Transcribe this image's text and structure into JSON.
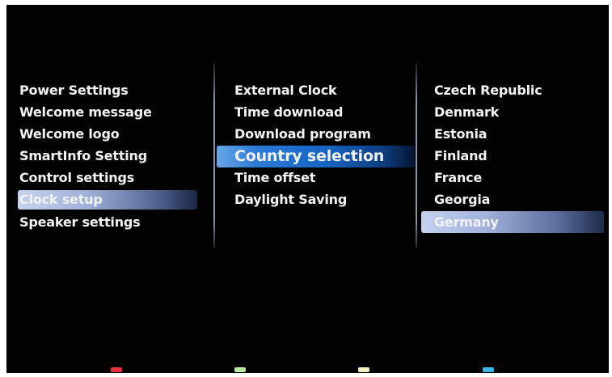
{
  "menu_level1": {
    "items": [
      {
        "label": "Power Settings"
      },
      {
        "label": "Welcome message"
      },
      {
        "label": "Welcome logo"
      },
      {
        "label": "SmartInfo Setting"
      },
      {
        "label": "Control settings"
      },
      {
        "label": "Clock setup"
      },
      {
        "label": "Speaker settings"
      }
    ],
    "selected": "Clock setup"
  },
  "menu_level2": {
    "items": [
      {
        "label": "External Clock"
      },
      {
        "label": "Time download"
      },
      {
        "label": "Download program"
      },
      {
        "label": "Country selection"
      },
      {
        "label": "Time offset"
      },
      {
        "label": "Daylight Saving"
      }
    ],
    "focused": "Country selection"
  },
  "menu_level3": {
    "items": [
      {
        "label": "Czech Republic"
      },
      {
        "label": "Denmark"
      },
      {
        "label": "Estonia"
      },
      {
        "label": "Finland"
      },
      {
        "label": "France"
      },
      {
        "label": "Georgia"
      },
      {
        "label": "Germany"
      }
    ],
    "selected": "Germany"
  },
  "color_keys": [
    {
      "name": "red",
      "color": "#e5323f"
    },
    {
      "name": "green",
      "color": "#b8e8a4"
    },
    {
      "name": "yellow",
      "color": "#f1efc0"
    },
    {
      "name": "blue",
      "color": "#3cb9ea"
    }
  ],
  "colors": {
    "background": "#020202",
    "text": "#f2f2f2",
    "focus_highlight": "#1865c4",
    "selection_highlight": "#a1b2dc"
  }
}
